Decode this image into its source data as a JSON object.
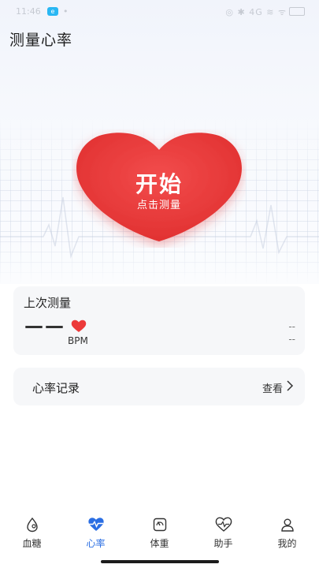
{
  "status_bar": {
    "time": "11:46",
    "app_badge": "e",
    "indicator": "•",
    "right": "◎ ✱ 4G ≋ ᯤ"
  },
  "header": {
    "title": "测量心率"
  },
  "heart_button": {
    "main_label": "开始",
    "sub_label": "点击测量",
    "color": "#ec3a3a"
  },
  "last_measurement": {
    "title": "上次测量",
    "value": "——",
    "unit": "BPM",
    "right_values": [
      "--",
      "--"
    ]
  },
  "record": {
    "label": "心率记录",
    "view_label": "查看",
    "chevron_icon": "chevron-right-icon"
  },
  "tabs": [
    {
      "label": "血糖",
      "icon": "blood-drop-icon",
      "active": false
    },
    {
      "label": "心率",
      "icon": "heart-pulse-icon",
      "active": true
    },
    {
      "label": "体重",
      "icon": "scale-icon",
      "active": false
    },
    {
      "label": "助手",
      "icon": "heart-assistant-icon",
      "active": false
    },
    {
      "label": "我的",
      "icon": "user-icon",
      "active": false
    }
  ],
  "colors": {
    "accent": "#2a6ee3",
    "heart": "#ec3a3a",
    "card_bg": "#f6f7f9"
  }
}
